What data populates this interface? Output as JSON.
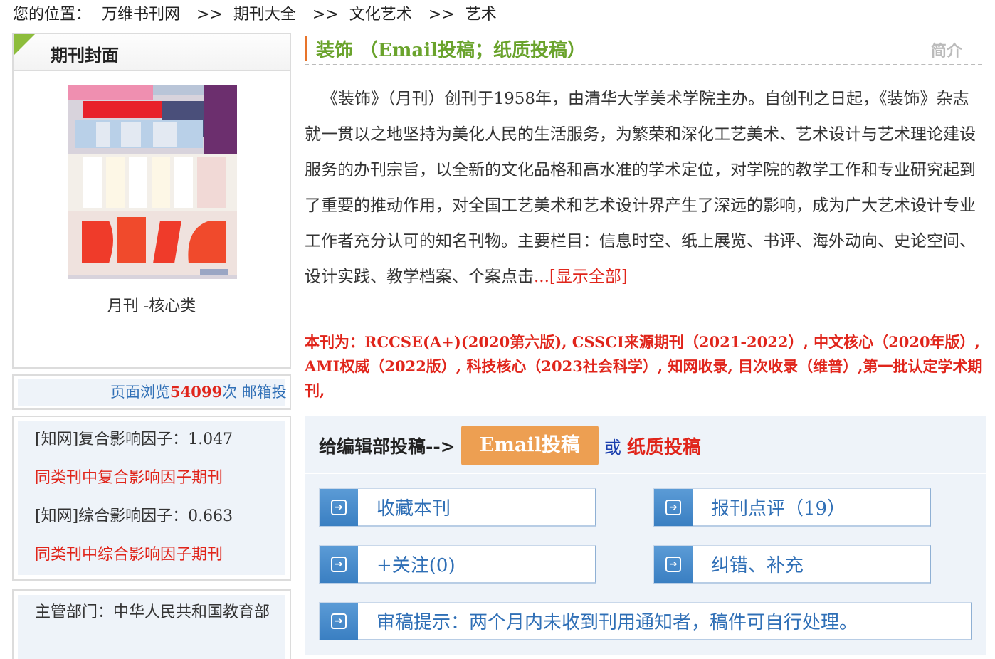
{
  "breadcrumb": {
    "prefix": "您的位置：",
    "items": [
      "万维书刊网",
      "期刊大全",
      "文化艺术",
      "艺术"
    ],
    "separator": ">>"
  },
  "cover": {
    "heading": "期刊封面",
    "frequency": "月刊 -核心类"
  },
  "stats": {
    "views_prefix": "页面浏览",
    "views_count": "54099",
    "views_suffix": "次 邮箱投"
  },
  "impact": {
    "composite_label": "[知网]复合影响因子：1.047",
    "composite_link": "同类刊中复合影响因子期刊",
    "comprehensive_label": "[知网]综合影响因子：0.663",
    "comprehensive_link": "同类刊中综合影响因子期刊"
  },
  "department": {
    "text": "主管部门：中华人民共和国教育部"
  },
  "journal": {
    "title": "装饰 （Email投稿；纸质投稿）",
    "intro_tab": "简介",
    "description": "《装饰》（月刊）创刊于1958年，由清华大学美术学院主办。自创刊之日起，《装饰》杂志就一贯以之地坚持为美化人民的生活服务，为繁荣和深化工艺美术、艺术设计与艺术理论建设服务的办刊宗旨，以全新的文化品格和高水准的学术定位，对学院的教学工作和专业研究起到了重要的推动作用，对全国工艺美术和艺术设计界产生了深远的影响，成为广大艺术设计专业工作者充分认可的知名刊物。主要栏目：信息时空、纸上展览、书评、海外动向、史论空间、设计实践、教学档案、个案点击",
    "show_all": "...[显示全部]",
    "indexing": "本刊为：RCCSE(A+)(2020第六版), CSSCI来源期刊（2021-2022）, 中文核心（2020年版）, AMI权威（2022版）, 科技核心（2023社会科学）, 知网收录, 目次收录（维普）,第一批认定学术期刊,"
  },
  "submit": {
    "label": "给编辑部投稿-->",
    "email_button": "Email投稿",
    "or": "或",
    "paper_link": "纸质投稿"
  },
  "actions": {
    "favorite": "收藏本刊",
    "review": "报刊点评（19）",
    "follow": "+关注(0)",
    "correct": "纠错、补充",
    "notice": "审稿提示：两个月内未收到刊用通知者，稿件可自行处理。"
  },
  "colors": {
    "accent_green": "#6aa32c",
    "link_blue": "#2f6fb6",
    "alert_red": "#e0251b",
    "button_orange": "#ed9f52",
    "panel_bg": "#eef3f9"
  }
}
